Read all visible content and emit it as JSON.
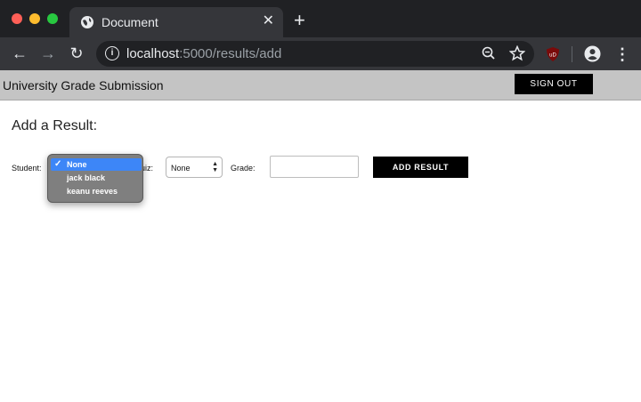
{
  "browser": {
    "tab_title": "Document",
    "url_host": "localhost",
    "url_rest": ":5000/results/add",
    "new_tab_symbol": "+",
    "close_symbol": "✕",
    "ext_badge": "uD"
  },
  "header": {
    "site_title": "University Grade Submission",
    "signout_label": "SIGN OUT"
  },
  "form": {
    "heading": "Add a Result:",
    "student_label": "Student:",
    "quiz_label_visible": "uiz:",
    "quiz_value": "None",
    "grade_label": "Grade:",
    "grade_value": "",
    "submit_label": "ADD RESULT"
  },
  "dropdown": {
    "options": [
      {
        "label": "None",
        "selected": true
      },
      {
        "label": "jack black",
        "selected": false
      },
      {
        "label": "keanu reeves",
        "selected": false
      }
    ],
    "check_symbol": "✓"
  },
  "colors": {
    "chrome_dark": "#202124",
    "tab_active": "#35363a",
    "header_bg": "#c4c4c4",
    "selection_blue": "#3d86f7",
    "button_black": "#000000"
  }
}
